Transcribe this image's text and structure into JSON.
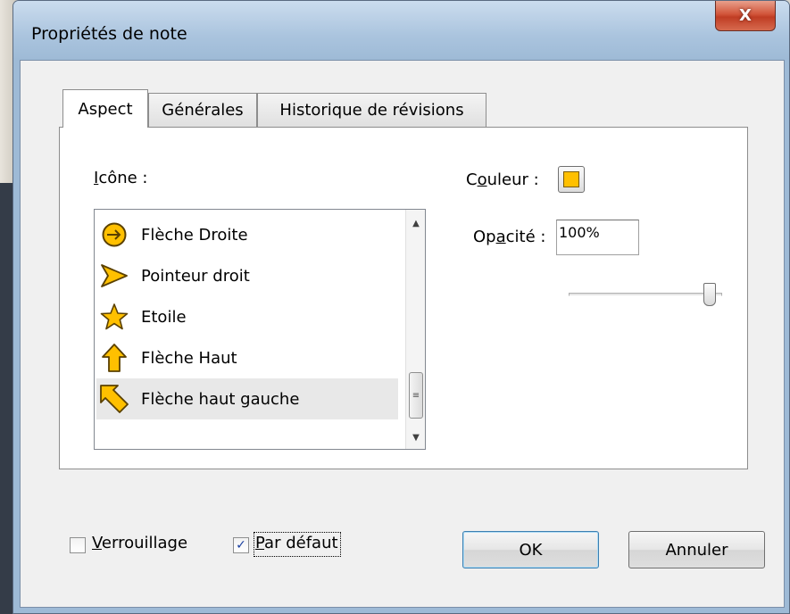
{
  "window": {
    "title": "Propriétés de note",
    "close_label": "X"
  },
  "tabs": [
    {
      "label": "Aspect",
      "active": true
    },
    {
      "label": "Générales",
      "active": false
    },
    {
      "label": "Historique de révisions",
      "active": false
    }
  ],
  "aspect": {
    "icon_label_prefix": "I",
    "icon_label_rest": "cône :",
    "color_label_prefix": "C",
    "color_label_u": "o",
    "color_label_rest": "uleur :",
    "color_value": "#ffc000",
    "opacity_label_prefix": "Op",
    "opacity_label_u": "a",
    "opacity_label_rest": "cité :",
    "opacity_value": "100%",
    "opacity_fraction": 1.0,
    "icons": [
      {
        "label": "Flèche Droite",
        "icon": "arrow-right-circle-icon",
        "selected": false
      },
      {
        "label": "Pointeur droit",
        "icon": "pointer-right-icon",
        "selected": false
      },
      {
        "label": "Etoile",
        "icon": "star-icon",
        "selected": false
      },
      {
        "label": "Flèche Haut",
        "icon": "arrow-up-icon",
        "selected": false
      },
      {
        "label": "Flèche haut gauche",
        "icon": "arrow-up-left-icon",
        "selected": true
      }
    ]
  },
  "footer": {
    "lock_label_u": "V",
    "lock_label_rest": "errouillage",
    "lock_checked": false,
    "default_label_u": "P",
    "default_label_rest": "ar défaut",
    "default_checked": true,
    "ok_label": "OK",
    "cancel_label": "Annuler"
  },
  "colors": {
    "icon_fill": "#ffc000",
    "icon_stroke": "#5a4000"
  }
}
